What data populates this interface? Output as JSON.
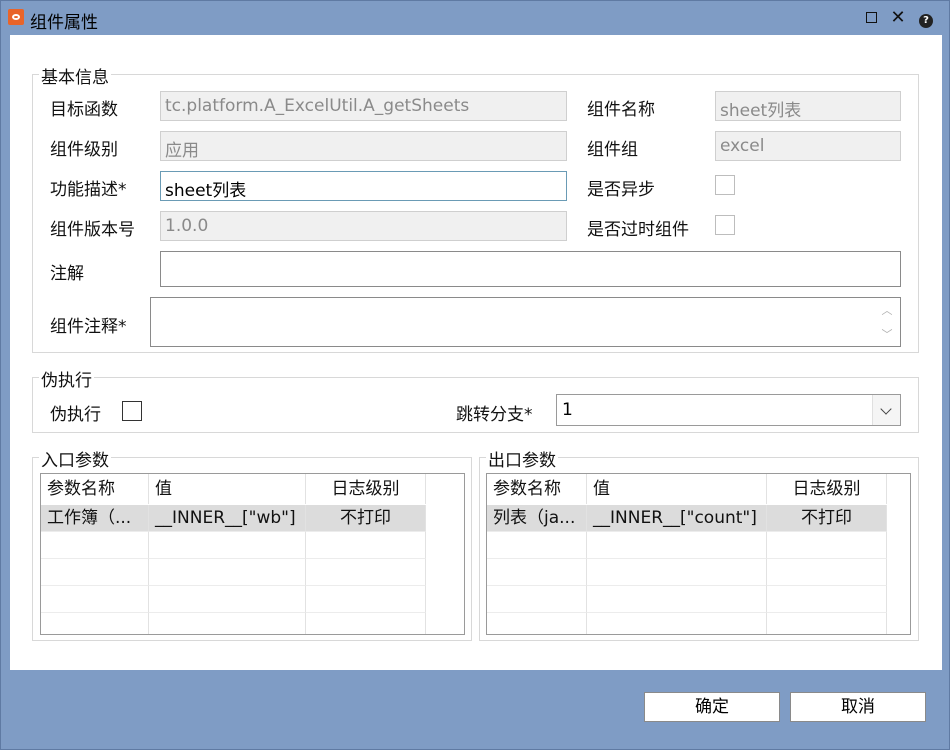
{
  "window": {
    "title": "组件属性"
  },
  "basic": {
    "legend": "基本信息",
    "target_func_label": "目标函数",
    "target_func_value": "tc.platform.A_ExcelUtil.A_getSheets",
    "comp_name_label": "组件名称",
    "comp_name_value": "sheet列表",
    "comp_level_label": "组件级别",
    "comp_level_value": "应用",
    "comp_group_label": "组件组",
    "comp_group_value": "excel",
    "func_desc_label": "功能描述*",
    "func_desc_value": "sheet列表",
    "async_label": "是否异步",
    "version_label": "组件版本号",
    "version_value": "1.0.0",
    "deprecated_label": "是否过时组件",
    "annotation_label": "注解",
    "annotation_value": "",
    "comment_label": "组件注释*",
    "comment_value": ""
  },
  "pseudo": {
    "legend": "伪执行",
    "pseudo_label": "伪执行",
    "jump_label": "跳转分支*",
    "jump_value": "1"
  },
  "input_params": {
    "legend": "入口参数",
    "columns": [
      "参数名称",
      "值",
      "日志级别"
    ],
    "rows": [
      {
        "name": "工作簿（...",
        "value": "__INNER__[\"wb\"]",
        "log": "不打印"
      }
    ]
  },
  "output_params": {
    "legend": "出口参数",
    "columns": [
      "参数名称",
      "值",
      "日志级别"
    ],
    "rows": [
      {
        "name": "列表（ja...",
        "value": "__INNER__[\"count\"]",
        "log": "不打印"
      }
    ]
  },
  "buttons": {
    "ok": "确定",
    "cancel": "取消"
  },
  "icons": {
    "app": "app-logo-icon",
    "maximize": "maximize-icon",
    "close": "close-icon",
    "help": "help-icon",
    "dropdown": "chevron-down-icon"
  }
}
